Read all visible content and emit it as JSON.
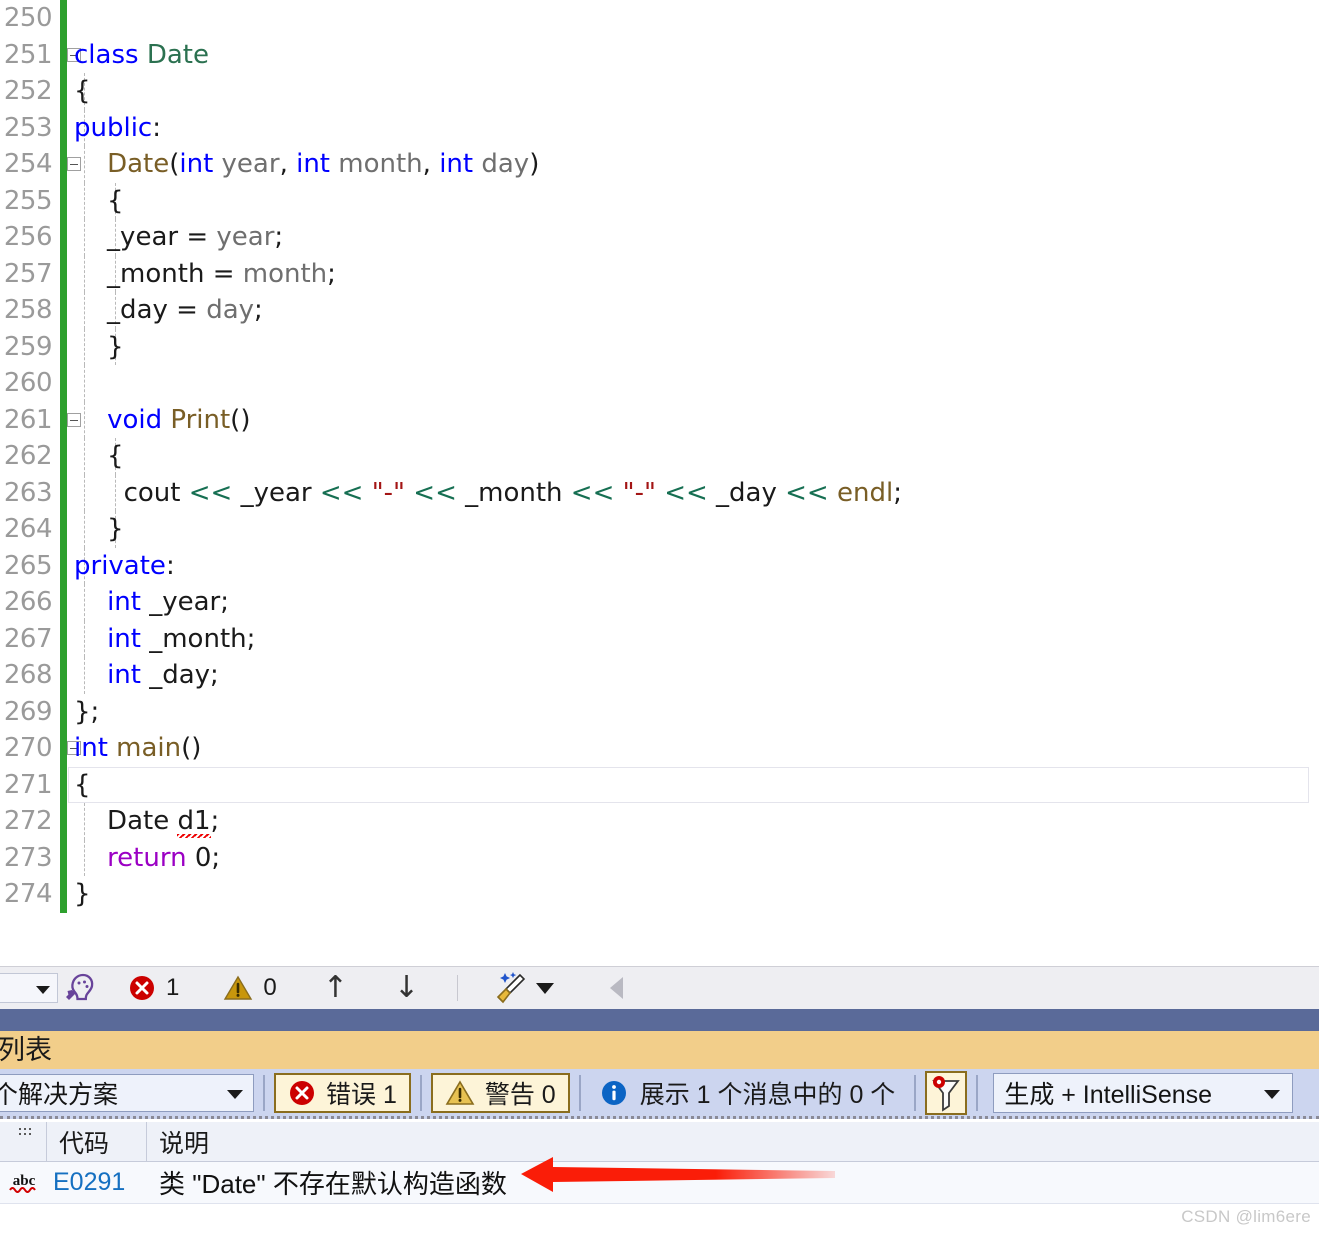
{
  "editor": {
    "first_line_number": 250,
    "lines": [
      {
        "n": 250,
        "tokens": [],
        "change": true,
        "collapse": false,
        "indent_guides": []
      },
      {
        "n": 251,
        "tokens": [
          {
            "t": "class ",
            "c": "k-blue"
          },
          {
            "t": "Date",
            "c": "k-type"
          }
        ],
        "change": true,
        "collapse": true,
        "indent_guides": []
      },
      {
        "n": 252,
        "tokens": [
          {
            "t": "{",
            "c": "k-plain"
          }
        ],
        "change": true,
        "collapse": false,
        "indent_guides": [
          84
        ]
      },
      {
        "n": 253,
        "tokens": [
          {
            "t": "public",
            "c": "k-blue"
          },
          {
            "t": ":",
            "c": "k-plain"
          }
        ],
        "change": true,
        "collapse": false,
        "indent_guides": [
          84
        ]
      },
      {
        "n": 254,
        "tokens": [
          {
            "t": "    ",
            "c": "k-plain"
          },
          {
            "t": "Date",
            "c": "k-fn"
          },
          {
            "t": "(",
            "c": "k-plain"
          },
          {
            "t": "int",
            "c": "k-blue"
          },
          {
            "t": " year",
            "c": "k-param"
          },
          {
            "t": ", ",
            "c": "k-plain"
          },
          {
            "t": "int",
            "c": "k-blue"
          },
          {
            "t": " month",
            "c": "k-param"
          },
          {
            "t": ", ",
            "c": "k-plain"
          },
          {
            "t": "int",
            "c": "k-blue"
          },
          {
            "t": " day",
            "c": "k-param"
          },
          {
            "t": ")",
            "c": "k-plain"
          }
        ],
        "change": true,
        "collapse": true,
        "indent_guides": [
          84
        ]
      },
      {
        "n": 255,
        "tokens": [
          {
            "t": "    {",
            "c": "k-plain"
          }
        ],
        "change": true,
        "collapse": false,
        "indent_guides": [
          84,
          115
        ]
      },
      {
        "n": 256,
        "tokens": [
          {
            "t": "    _year = ",
            "c": "k-plain"
          },
          {
            "t": "year",
            "c": "k-param"
          },
          {
            "t": ";",
            "c": "k-plain"
          }
        ],
        "change": true,
        "collapse": false,
        "indent_guides": [
          84,
          115
        ]
      },
      {
        "n": 257,
        "tokens": [
          {
            "t": "    _month = ",
            "c": "k-plain"
          },
          {
            "t": "month",
            "c": "k-param"
          },
          {
            "t": ";",
            "c": "k-plain"
          }
        ],
        "change": true,
        "collapse": false,
        "indent_guides": [
          84,
          115
        ]
      },
      {
        "n": 258,
        "tokens": [
          {
            "t": "    _day = ",
            "c": "k-plain"
          },
          {
            "t": "day",
            "c": "k-param"
          },
          {
            "t": ";",
            "c": "k-plain"
          }
        ],
        "change": true,
        "collapse": false,
        "indent_guides": [
          84,
          115
        ]
      },
      {
        "n": 259,
        "tokens": [
          {
            "t": "    }",
            "c": "k-plain"
          }
        ],
        "change": true,
        "collapse": false,
        "indent_guides": [
          84,
          115
        ]
      },
      {
        "n": 260,
        "tokens": [],
        "change": true,
        "collapse": false,
        "indent_guides": [
          84
        ]
      },
      {
        "n": 261,
        "tokens": [
          {
            "t": "    ",
            "c": "k-plain"
          },
          {
            "t": "void",
            "c": "k-blue"
          },
          {
            "t": " ",
            "c": "k-plain"
          },
          {
            "t": "Print",
            "c": "k-fn"
          },
          {
            "t": "()",
            "c": "k-plain"
          }
        ],
        "change": true,
        "collapse": true,
        "indent_guides": [
          84
        ]
      },
      {
        "n": 262,
        "tokens": [
          {
            "t": "    {",
            "c": "k-plain"
          }
        ],
        "change": true,
        "collapse": false,
        "indent_guides": [
          84,
          115
        ]
      },
      {
        "n": 263,
        "tokens": [
          {
            "t": "      cout ",
            "c": "k-plain"
          },
          {
            "t": "<<",
            "c": "k-op"
          },
          {
            "t": " _year ",
            "c": "k-plain"
          },
          {
            "t": "<<",
            "c": "k-op"
          },
          {
            "t": " ",
            "c": "k-plain"
          },
          {
            "t": "\"-\"",
            "c": "k-str"
          },
          {
            "t": " ",
            "c": "k-plain"
          },
          {
            "t": "<<",
            "c": "k-op"
          },
          {
            "t": " _month ",
            "c": "k-plain"
          },
          {
            "t": "<<",
            "c": "k-op"
          },
          {
            "t": " ",
            "c": "k-plain"
          },
          {
            "t": "\"-\"",
            "c": "k-str"
          },
          {
            "t": " ",
            "c": "k-plain"
          },
          {
            "t": "<<",
            "c": "k-op"
          },
          {
            "t": " _day ",
            "c": "k-plain"
          },
          {
            "t": "<<",
            "c": "k-op"
          },
          {
            "t": " ",
            "c": "k-plain"
          },
          {
            "t": "endl",
            "c": "k-fn"
          },
          {
            "t": ";",
            "c": "k-plain"
          }
        ],
        "change": true,
        "collapse": false,
        "indent_guides": [
          84,
          115
        ]
      },
      {
        "n": 264,
        "tokens": [
          {
            "t": "    }",
            "c": "k-plain"
          }
        ],
        "change": true,
        "collapse": false,
        "indent_guides": [
          84,
          115
        ]
      },
      {
        "n": 265,
        "tokens": [
          {
            "t": "private",
            "c": "k-blue"
          },
          {
            "t": ":",
            "c": "k-plain"
          }
        ],
        "change": true,
        "collapse": false,
        "indent_guides": [
          84
        ]
      },
      {
        "n": 266,
        "tokens": [
          {
            "t": "    ",
            "c": "k-plain"
          },
          {
            "t": "int",
            "c": "k-blue"
          },
          {
            "t": " _year;",
            "c": "k-plain"
          }
        ],
        "change": true,
        "collapse": false,
        "indent_guides": [
          84
        ]
      },
      {
        "n": 267,
        "tokens": [
          {
            "t": "    ",
            "c": "k-plain"
          },
          {
            "t": "int",
            "c": "k-blue"
          },
          {
            "t": " _month;",
            "c": "k-plain"
          }
        ],
        "change": true,
        "collapse": false,
        "indent_guides": [
          84
        ]
      },
      {
        "n": 268,
        "tokens": [
          {
            "t": "    ",
            "c": "k-plain"
          },
          {
            "t": "int",
            "c": "k-blue"
          },
          {
            "t": " _day;",
            "c": "k-plain"
          }
        ],
        "change": true,
        "collapse": false,
        "indent_guides": [
          84
        ]
      },
      {
        "n": 269,
        "tokens": [
          {
            "t": "};",
            "c": "k-plain"
          }
        ],
        "change": true,
        "collapse": false,
        "indent_guides": []
      },
      {
        "n": 270,
        "tokens": [
          {
            "t": "int",
            "c": "k-blue"
          },
          {
            "t": " ",
            "c": "k-plain"
          },
          {
            "t": "main",
            "c": "k-fn"
          },
          {
            "t": "()",
            "c": "k-plain"
          }
        ],
        "change": true,
        "collapse": true,
        "indent_guides": []
      },
      {
        "n": 271,
        "tokens": [
          {
            "t": "{",
            "c": "k-plain"
          }
        ],
        "change": true,
        "collapse": false,
        "current": true,
        "indent_guides": []
      },
      {
        "n": 272,
        "tokens": [
          {
            "t": "    Date ",
            "c": "k-plain"
          },
          {
            "t": "d1",
            "c": "k-plain",
            "squiggle": true
          },
          {
            "t": ";",
            "c": "k-plain"
          }
        ],
        "change": true,
        "collapse": false,
        "indent_guides": [
          84
        ]
      },
      {
        "n": 273,
        "tokens": [
          {
            "t": "    ",
            "c": "k-plain"
          },
          {
            "t": "return",
            "c": "k-kw2"
          },
          {
            "t": " 0;",
            "c": "k-plain"
          }
        ],
        "change": true,
        "collapse": false,
        "indent_guides": [
          84
        ]
      },
      {
        "n": 274,
        "tokens": [
          {
            "t": "}",
            "c": "k-plain"
          }
        ],
        "change": true,
        "collapse": false,
        "indent_guides": []
      }
    ]
  },
  "toolbar": {
    "combo_value": "",
    "quick_actions_icon": "quick-actions-icon",
    "error_icon": "error-circle-icon",
    "error_count": "1",
    "warning_icon": "warning-triangle-icon",
    "warning_count": "0",
    "prev_label": "↑",
    "next_label": "↓",
    "cleanup_icon": "code-cleanup-broom-icon",
    "overflow_icon": "overflow-chevron-icon"
  },
  "panel": {
    "title": "列表",
    "filter": {
      "scope_value": "个解决方案",
      "error_toggle_label": "错误 1",
      "warning_toggle_label": "警告 0",
      "info_label": "展示 1 个消息中的 0 个",
      "funnel_icon": "filter-funnel-icon",
      "source_value": "生成 + IntelliSense"
    },
    "columns": [
      "代码",
      "说明"
    ],
    "rows": [
      {
        "icon": "intellisense-abc-icon",
        "code": "E0291",
        "description": "类 \"Date\" 不存在默认构造函数"
      }
    ]
  },
  "annotation": {
    "arrow_color": "#fa1d08",
    "arrow_direction": "left"
  },
  "watermark": "CSDN @lim6ere",
  "colors": {
    "accent_bar": "#5a6a99",
    "panel_title_bg": "#f2ce8a",
    "filter_bar_bg": "#ccd5ef",
    "toolbar_bg": "#eeeef2",
    "change_bar_green": "#2ea02e",
    "error_red": "#cc0000",
    "warning_amber": "#b8860b",
    "info_blue": "#0b64c4",
    "code_link_blue": "#1570c1"
  }
}
